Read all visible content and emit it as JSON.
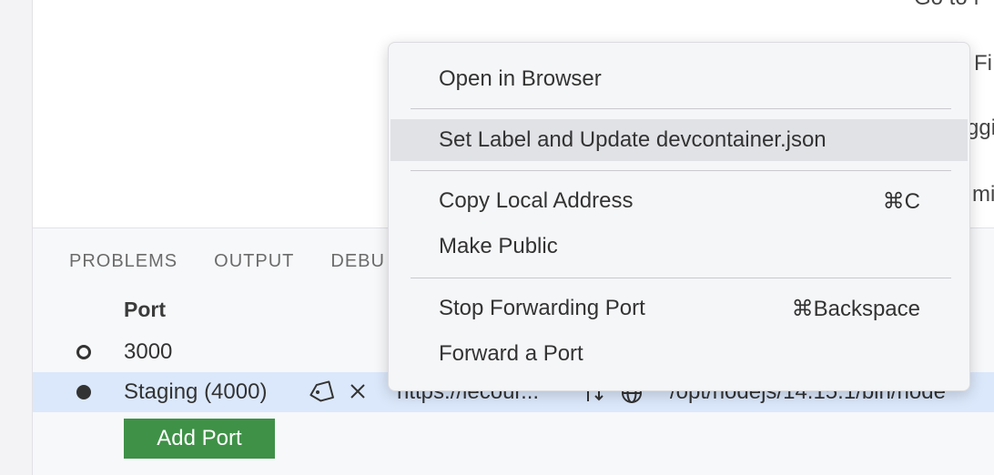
{
  "editor": {
    "snippets": [
      "Go to f",
      "Fi",
      "ggi",
      "mi"
    ]
  },
  "panel": {
    "tabs": [
      "PROBLEMS",
      "OUTPUT",
      "DEBU"
    ],
    "column_header": "Port",
    "rows": [
      {
        "port": "3000",
        "address": "",
        "process": ""
      },
      {
        "port": "Staging (4000)",
        "address": "https://lecour...",
        "process": "/opt/nodejs/14.15.1/bin/node"
      }
    ],
    "add_port_label": "Add Port"
  },
  "context_menu": {
    "items": [
      {
        "label": "Open in Browser",
        "shortcut": ""
      },
      {
        "label": "Set Label and Update devcontainer.json",
        "shortcut": ""
      },
      {
        "label": "Copy Local Address",
        "shortcut": "⌘C"
      },
      {
        "label": "Make Public",
        "shortcut": ""
      },
      {
        "label": "Stop Forwarding Port",
        "shortcut": "⌘Backspace"
      },
      {
        "label": "Forward a Port",
        "shortcut": ""
      }
    ]
  },
  "colors": {
    "add_port_button": "#3f9147",
    "selected_row": "#dbe8fb",
    "menu_hover": "#e1e2e6"
  }
}
